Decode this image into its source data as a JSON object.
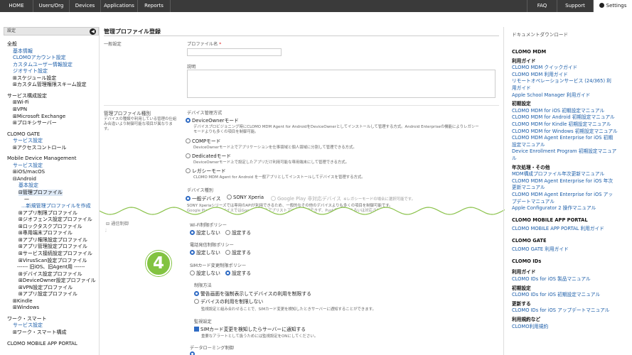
{
  "topnav": {
    "home": "HOME",
    "users_org": "Users/Org",
    "devices": "Devices",
    "applications": "Applications",
    "reports": "Reports",
    "faq": "FAQ",
    "support": "Support",
    "settings": "Settings"
  },
  "sidebar": {
    "header": "設定",
    "items": [
      "全般",
      "基本情報",
      "CLOMOアカウント設定",
      "カスタムユーザー情報設定",
      "ジオサイト設定",
      "⊞スケジュール設定",
      "⊞カスタム管理権限スキーム設定",
      "サービス構成設定",
      "⊞Wi-Fi",
      "⊞VPN",
      "⊞Microsoft Exchange",
      "⊞プロキシサーバー",
      "CLOMO GATE",
      "サービス設定",
      "⊞アクセスコントロール",
      "Mobile Device Management",
      "サービス設定",
      "⊞iOS/macOS",
      "⊟Android",
      "基本設定",
      "⊟管理プロファイル",
      "一",
      "...新規管理プロファイルを作成",
      "⊞アプリ制限プロファイル",
      "⊞ジオフェンス設定プロファイル",
      "⊞ロックタスクプロファイル",
      "⊞専用端末プロファイル",
      "⊞アプリ権限設定プロファイル",
      "⊞アプリ管理設定プロファイル",
      "⊞サービス接続設定プロファイル",
      "⊞VirusScan設定プロファイル",
      "------ 旧iOS、旧Agent用 ------",
      "⊞デバイス設定プロファイル",
      "⊞DeviceOwner設定プロファイル",
      "⊞VPN設定プロファイル",
      "⊞アプリ設定プロファイル",
      "⊞Kindle",
      "⊞Windows",
      "ワーク・スマート",
      "サービス設定",
      "⊞ワーク・スマート構成",
      "CLOMO MOBILE APP PORTAL"
    ]
  },
  "main": {
    "page_title": "管理プロファイル登録",
    "general_label": "一般設定",
    "profile_name_label": "プロファイル名",
    "required_mark": "*",
    "description_label": "説明",
    "type_heading": "管理プロファイル種別",
    "type_help_1": "デバイスの種類や利用している管理の仕組",
    "type_help_2": "み合違いより制御可能な項目が異なりま",
    "type_help_3": "す。",
    "mgmt_method_label": "デバイス管理方式",
    "opt_deviceowner": "DeviceOwnerモード",
    "opt_deviceowner_desc_1": "デバイスプロビジョニング時にCLOMO MDM Agent for AndroidをDeviceOwnerとしてインストールして管理する方式。Android Enterpriseの機能によりレガシー",
    "opt_deviceowner_desc_2": "モードよりも多くの項目を制御可能。",
    "opt_comp": "COMPモード",
    "opt_comp_desc": "DeviceOwnerモード上でアプリケーションを仕事領域と個人領域に分割して管理できる方式。",
    "opt_dedicated": "Dedicatedモード",
    "opt_dedicated_desc": "DeviceOwnerモード上で設定したアプリだけ利用可能な専用端末にして管理できる方式。",
    "opt_legacy": "レガシーモード",
    "opt_legacy_desc": "CLOMO MDM Agent for Android を一般アプリとしてインストールしてデバイスを管理する方式。",
    "device_model_label": "デバイス種別",
    "model_general": "一般デバイス",
    "model_sony": "SONY Xperia",
    "model_gplay": "Google Play 非対応デバイス",
    "model_note": "※レガシーモードの場合に選択可能です。",
    "model_desc_1": "SONY Xperiaシリーズでは専用のAPIが利用できるため、一般的なその他のデバイスよりも多くの項目を制御可能です。",
    "model_desc_2": "Google Play 対応デバイスではGoogle Playのアプリストアにより利用できず、Push機能制御あるいは対応されません。",
    "comm_label": "⊟ 通信制御",
    "comm_sub": ";",
    "wifi_label": "Wi-Fi制限ポリシー",
    "bt_label": "電話発信制限ポリシー",
    "sim_label": "SIMカード変更制限ポリシー",
    "no_setting": "設定しない",
    "setting": "設定する",
    "limit_method_label": "制限方法",
    "warn_opt": "警告画面を強制表示してデバイスの利用を制限する",
    "noblock_opt": "デバイスの利用を制限しない",
    "noblock_desc": "監視設定と組み合わせることで、SIMカード変更を検知したときサーバーに通知することができます。",
    "monitor_label": "監視設定",
    "monitor_opt": "SIMカード変更を検知したらサーバーに通知する",
    "monitor_desc": "重要なアラートとして扱うためには監視設定をONにしてください。",
    "roaming_label": "データローミング制御",
    "badge_number": "4"
  },
  "rightcol": {
    "heading": "ドキュメントダウンロード",
    "lines": [
      {
        "t": "CLOMO MDM",
        "k": "hd"
      },
      {
        "t": "利用ガイド",
        "k": "sub"
      },
      {
        "t": "CLOMO MDM クイックガイド",
        "k": "lnk"
      },
      {
        "t": "CLOMO MDM 利用ガイド",
        "k": "lnk"
      },
      {
        "t": "リモートオペレーションサービス (24/365) 利",
        "k": "lnk"
      },
      {
        "t": "用ガイド",
        "k": "lnk"
      },
      {
        "t": "Apple School Manager 利用ガイド",
        "k": "lnk"
      },
      {
        "t": "初期設定",
        "k": "sub"
      },
      {
        "t": "CLOMO MDM for iOS 初期設定マニュアル",
        "k": "lnk"
      },
      {
        "t": "CLOMO MDM for Android 初期設定マニュアル",
        "k": "lnk"
      },
      {
        "t": "CLOMO MDM for Kindle 初期設定マニュアル",
        "k": "lnk"
      },
      {
        "t": "CLOMO MDM for Windows 初期設定マニュアル",
        "k": "lnk"
      },
      {
        "t": "CLOMO MDM Agent Enterprise for iOS 初期",
        "k": "lnk"
      },
      {
        "t": "設定マニュアル",
        "k": "lnk"
      },
      {
        "t": "Device Enrollment Program 初期設定マニュア",
        "k": "lnk"
      },
      {
        "t": "ル",
        "k": "lnk"
      },
      {
        "t": "年次処理・その他",
        "k": "sub"
      },
      {
        "t": "MDM構成プロファイル年次更新マニュアル",
        "k": "lnk"
      },
      {
        "t": "CLOMO MDM Agent Enterprise for iOS 年次",
        "k": "lnk"
      },
      {
        "t": "更新マニュアル",
        "k": "lnk"
      },
      {
        "t": "CLOMO MDM Agent Enterprise for iOS アッ",
        "k": "lnk"
      },
      {
        "t": "プデートマニュアル",
        "k": "lnk"
      },
      {
        "t": "Apple Configurator 2 操作マニュアル",
        "k": "lnk"
      },
      {
        "t": "CLOMO MOBILE APP PORTAL",
        "k": "hd"
      },
      {
        "t": "CLOMO MOBILE APP PORTAL 利用ガイド",
        "k": "lnk"
      },
      {
        "t": "CLOMO GATE",
        "k": "hd"
      },
      {
        "t": "CLOMO GATE 利用ガイド",
        "k": "lnk"
      },
      {
        "t": "CLOMO IDs",
        "k": "hd"
      },
      {
        "t": "利用ガイド",
        "k": "sub"
      },
      {
        "t": "CLOMO IDs for iOS 製品マニュアル",
        "k": "lnk"
      },
      {
        "t": "初期設定",
        "k": "sub"
      },
      {
        "t": "CLOMO IDs for iOS 初期設定マニュアル",
        "k": "lnk"
      },
      {
        "t": "更新する",
        "k": "sub"
      },
      {
        "t": "CLOMO IDs for iOS アップデートマニュアル",
        "k": "lnk"
      },
      {
        "t": "利用規約など",
        "k": "sub"
      },
      {
        "t": "CLOMO利用規約",
        "k": "lnk"
      }
    ]
  }
}
